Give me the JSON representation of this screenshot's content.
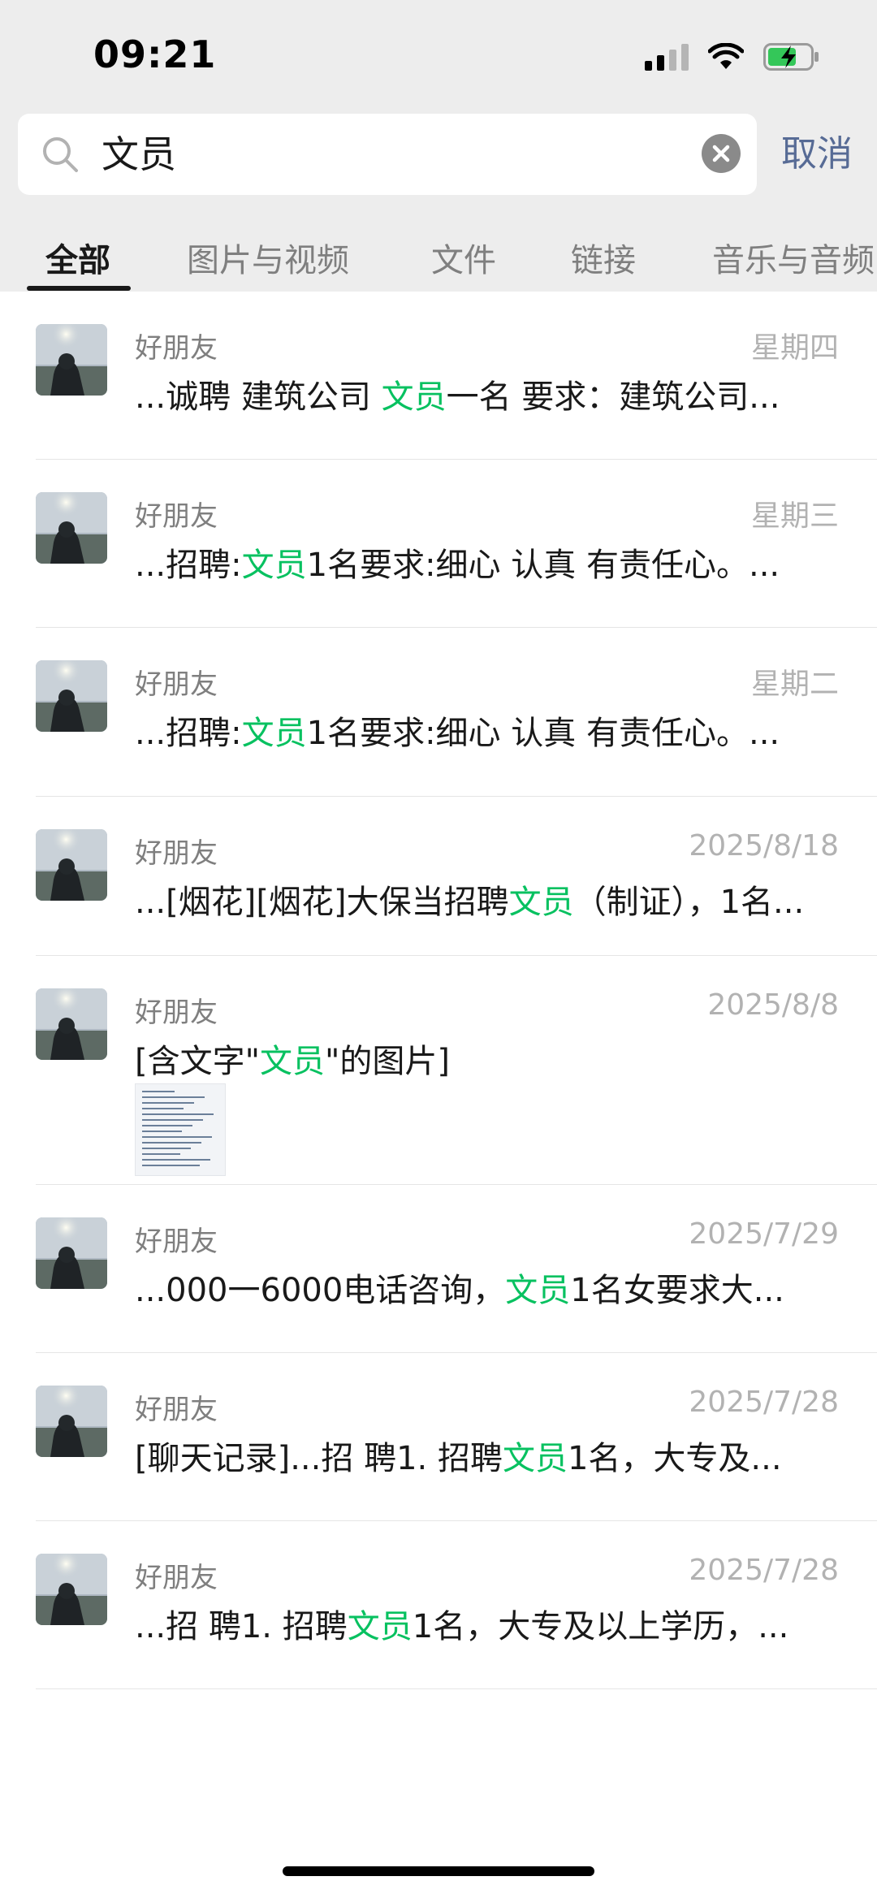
{
  "status_bar": {
    "time": "09:21"
  },
  "search": {
    "query": "文员",
    "cancel_label": "取消"
  },
  "tabs": [
    {
      "label": "全部",
      "active": true
    },
    {
      "label": "图片与视频",
      "active": false
    },
    {
      "label": "文件",
      "active": false
    },
    {
      "label": "链接",
      "active": false
    },
    {
      "label": "音乐与音频",
      "active": false
    }
  ],
  "results": [
    {
      "sender": "好朋友",
      "date": "星期四",
      "pre": "...诚聘  建筑公司  ",
      "hl": "文员",
      "post": "一名 要求：建筑公司..."
    },
    {
      "sender": "好朋友",
      "date": "星期三",
      "pre": "...招聘:",
      "hl": "文员",
      "post": "1名要求:细心 认真 有责任心。..."
    },
    {
      "sender": "好朋友",
      "date": "星期二",
      "pre": "...招聘:",
      "hl": "文员",
      "post": "1名要求:细心 认真 有责任心。..."
    },
    {
      "sender": "好朋友",
      "date": "2025/8/18",
      "pre": "...[烟花][烟花]大保当招聘",
      "hl": "文员",
      "post": "（制证），1名..."
    },
    {
      "sender": "好朋友",
      "date": "2025/8/8",
      "pre": "[含文字\"",
      "hl": "文员",
      "post": "\"的图片]",
      "has_image": true
    },
    {
      "sender": "好朋友",
      "date": "2025/7/29",
      "pre": "...000一6000电话咨询，",
      "hl": "文员",
      "post": "1名女要求大..."
    },
    {
      "sender": "好朋友",
      "date": "2025/7/28",
      "pre": "[聊天记录]...招   聘1. 招聘",
      "hl": "文员",
      "post": "1名，大专及..."
    },
    {
      "sender": "好朋友",
      "date": "2025/7/28",
      "pre": "...招   聘1. 招聘",
      "hl": "文员",
      "post": "1名，大专及以上学历，..."
    }
  ],
  "colors": {
    "highlight": "#07c160",
    "cancel": "#576b95",
    "header_bg": "#ededed"
  }
}
